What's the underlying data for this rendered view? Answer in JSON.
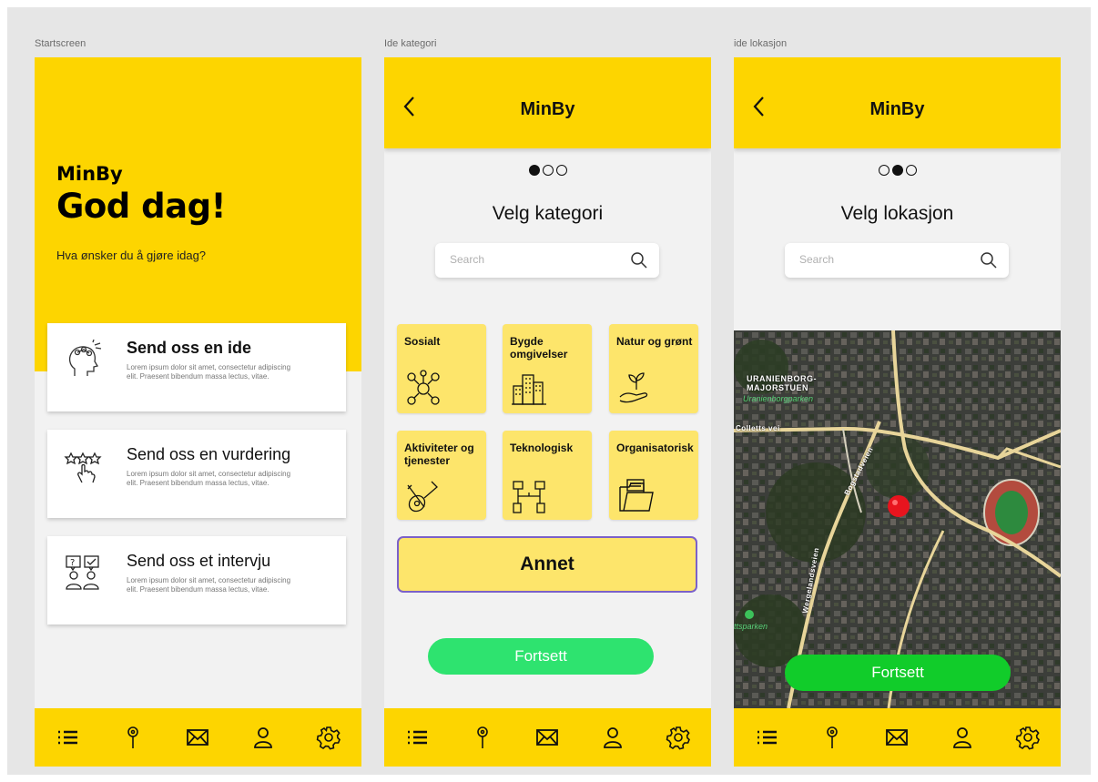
{
  "frames": {
    "start": "Startscreen",
    "category": "Ide kategori",
    "location": "ide lokasjon"
  },
  "start": {
    "app_name": "MinBy",
    "greeting": "God dag!",
    "question": "Hva ønsker du å gjøre idag?",
    "cards": [
      {
        "title": "Send oss en ide",
        "desc": "Lorem ipsum dolor sit amet, consectetur adipiscing elit. Praesent bibendum massa lectus, vitae.",
        "icon": "head-idea-icon"
      },
      {
        "title": "Send oss en vurdering",
        "desc": "Lorem ipsum dolor sit amet, consectetur adipiscing elit. Praesent bibendum massa lectus, vitae.",
        "icon": "rating-stars-hand-icon"
      },
      {
        "title": "Send oss et intervju",
        "desc": "Lorem ipsum dolor sit amet, consectetur adipiscing elit. Praesent bibendum massa lectus, vitae.",
        "icon": "interview-people-icon"
      }
    ]
  },
  "header": {
    "title": "MinBy"
  },
  "category": {
    "title": "Velg kategori",
    "search_placeholder": "Search",
    "tiles": [
      {
        "label": "Sosialt",
        "icon": "social-network-icon"
      },
      {
        "label": "Bygde omgivelser",
        "icon": "buildings-icon"
      },
      {
        "label": "Natur og grønt",
        "icon": "plant-hand-icon"
      },
      {
        "label": "Aktiviteter og tjenester",
        "icon": "guitar-icon"
      },
      {
        "label": "Teknologisk",
        "icon": "technology-icon"
      },
      {
        "label": "Organisatorisk",
        "icon": "folder-icon"
      }
    ],
    "other_label": "Annet",
    "continue_label": "Fortsett"
  },
  "location": {
    "title": "Velg lokasjon",
    "search_placeholder": "Search",
    "map_labels": {
      "district1": "URANIENBORG-",
      "district2": "MAJORSTUEN",
      "park": "Uranienborgparken",
      "street1": "Colletts vei",
      "street2": "Bogstadveien",
      "street3": "Wergelandsveien",
      "park2": "ttsparken"
    },
    "continue_label": "Fortsett"
  },
  "nav": [
    "list-icon",
    "map-pin-icon",
    "mail-icon",
    "user-icon",
    "settings-gear-icon"
  ],
  "colors": {
    "primary": "#fdd500",
    "tile": "#fde56b",
    "accent_green": "#2ee36f",
    "map_button_green": "#11cc2a",
    "selected_border": "#7b61c9",
    "pin": "#e8141e"
  }
}
